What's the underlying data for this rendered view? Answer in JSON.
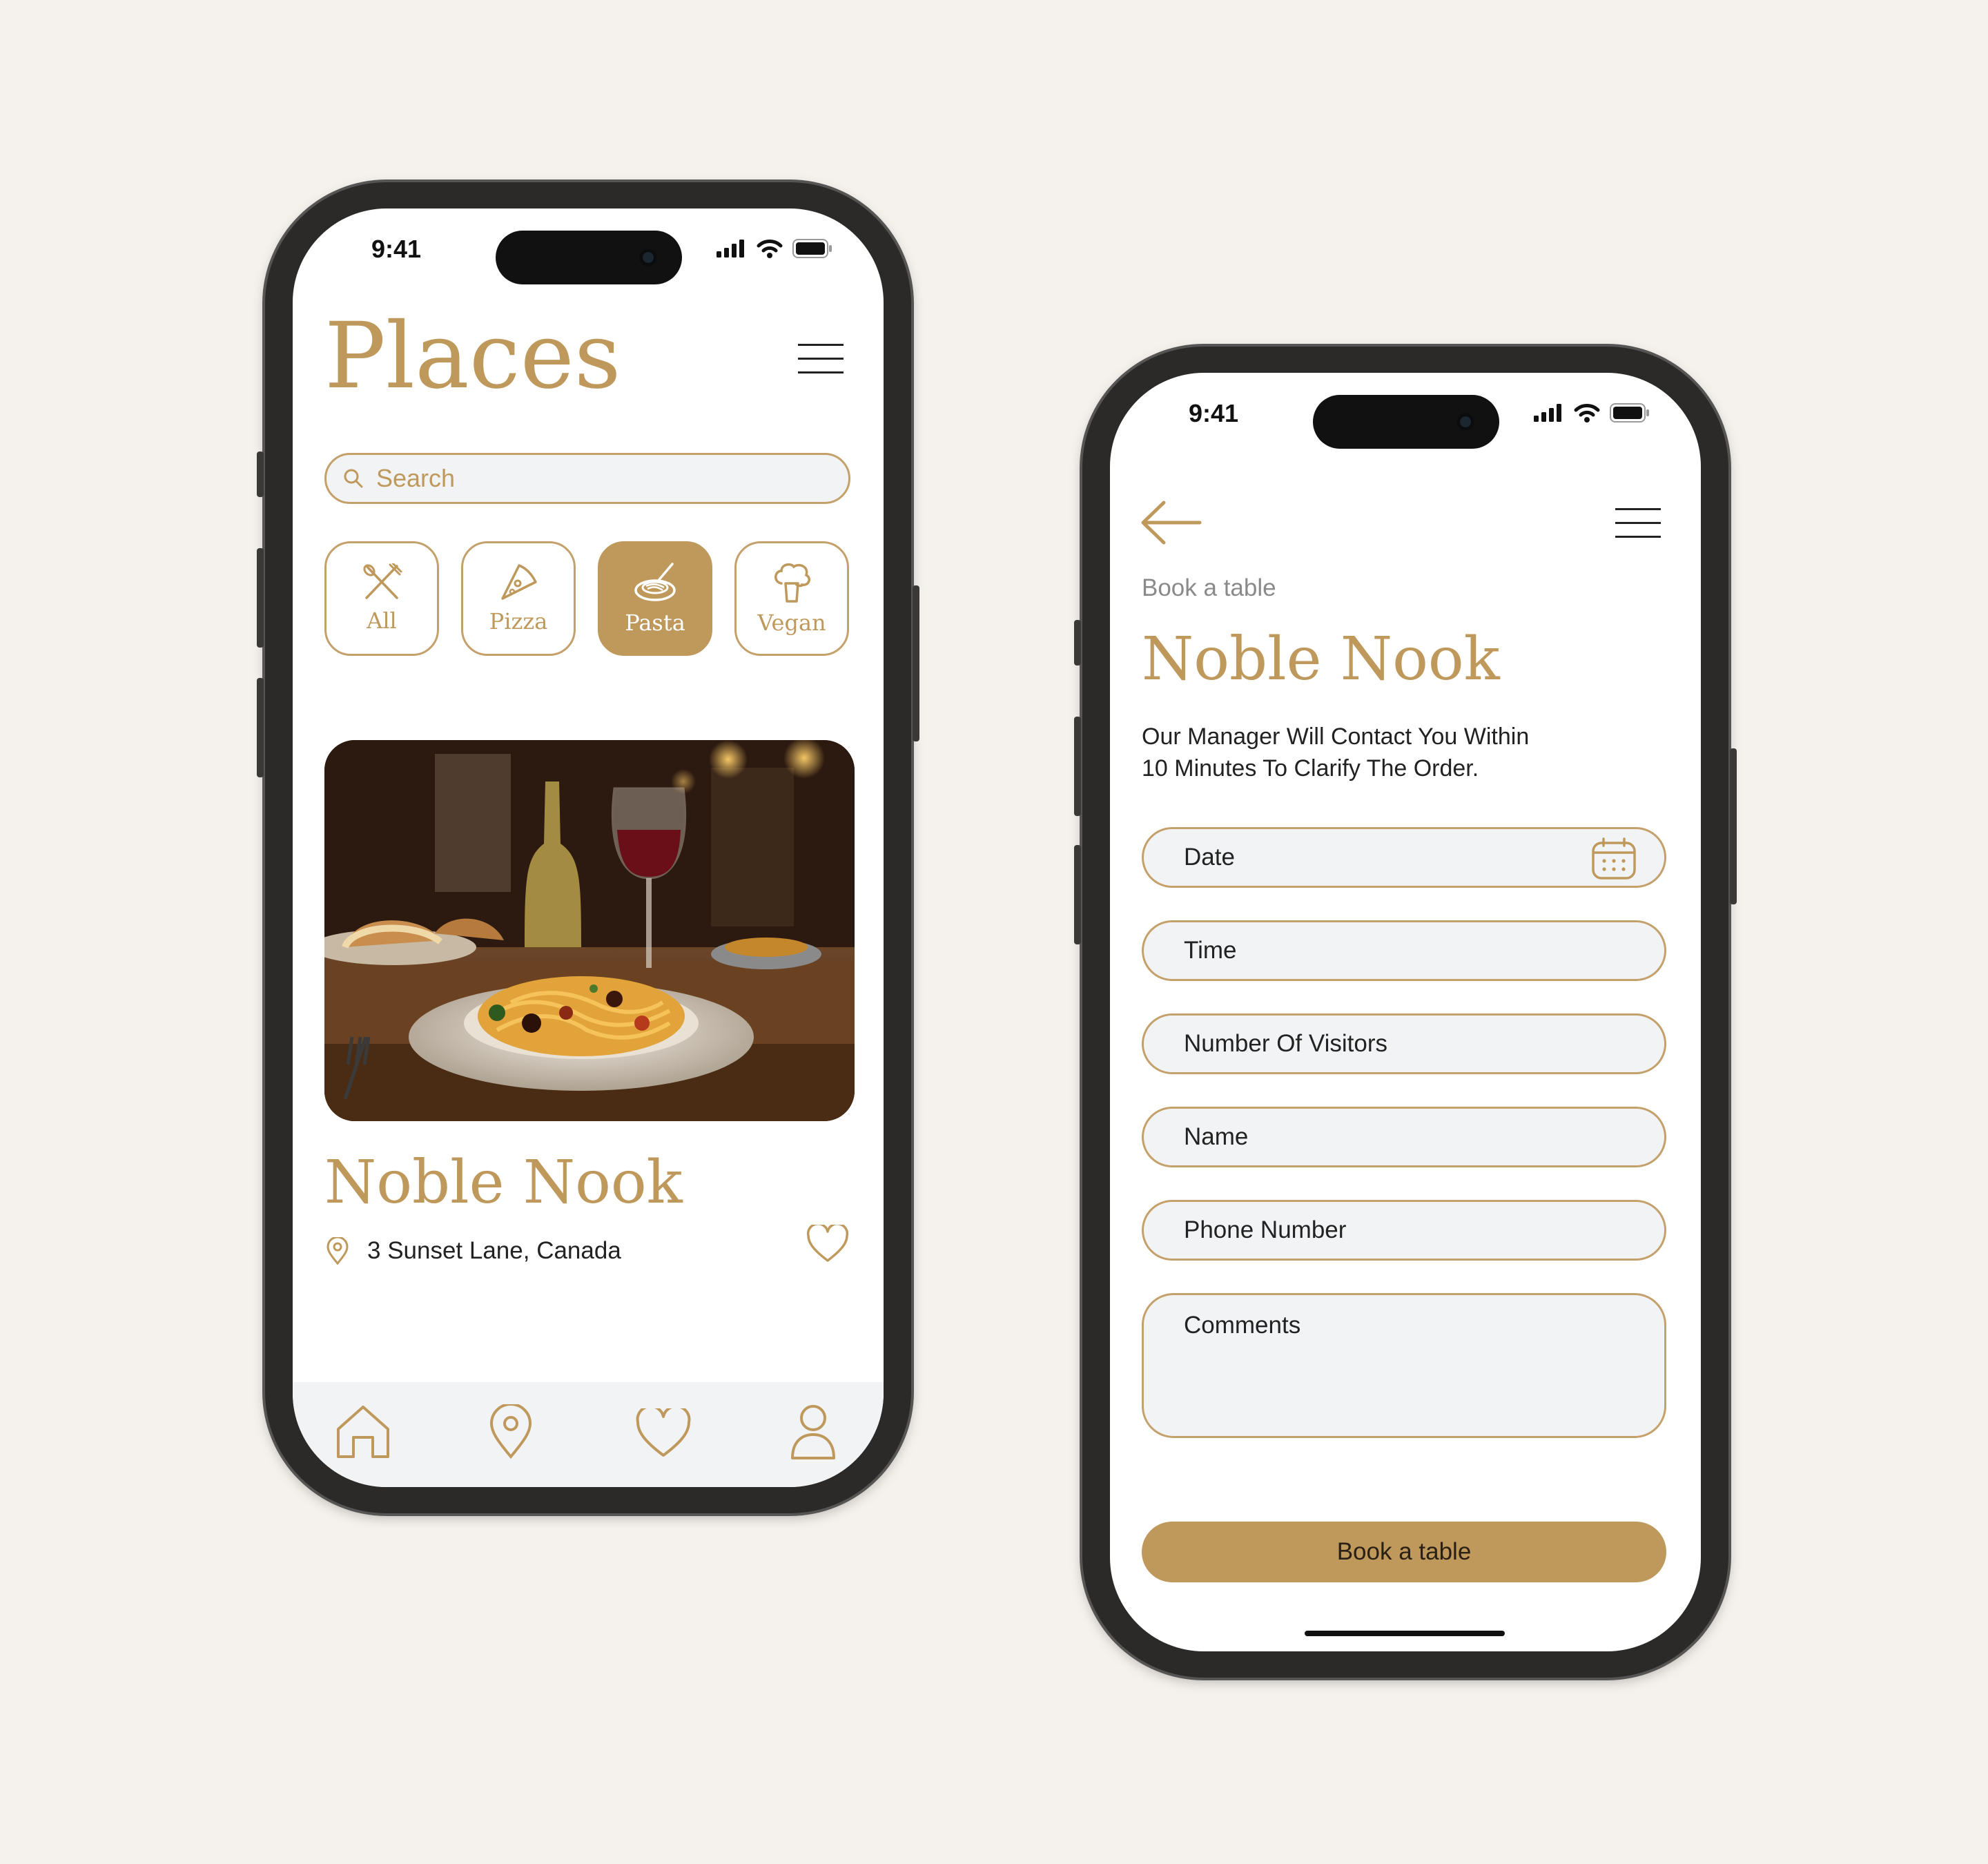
{
  "theme": {
    "accent": "#bf995c",
    "field_bg": "#f2f3f5",
    "page_bg": "#f5f1ec"
  },
  "left_phone": {
    "status_time": "9:41",
    "title": "Places",
    "menu_icon": "hamburger-icon",
    "search": {
      "placeholder": "Search",
      "icon": "search-icon"
    },
    "categories": [
      {
        "label": "All",
        "icon": "utensils-icon",
        "active": false
      },
      {
        "label": "Pizza",
        "icon": "pizza-icon",
        "active": false
      },
      {
        "label": "Pasta",
        "icon": "pasta-icon",
        "active": true
      },
      {
        "label": "Vegan",
        "icon": "broccoli-icon",
        "active": false
      }
    ],
    "card": {
      "image": "pasta-dish-photo",
      "name": "Noble Nook",
      "address": "3 Sunset Lane, Canada",
      "location_icon": "location-pin-icon",
      "favorite_icon": "heart-icon"
    },
    "bottom_nav": [
      {
        "icon": "home-icon"
      },
      {
        "icon": "location-pin-icon"
      },
      {
        "icon": "heart-icon"
      },
      {
        "icon": "user-icon"
      }
    ]
  },
  "right_phone": {
    "status_time": "9:41",
    "back_icon": "arrow-left-icon",
    "menu_icon": "hamburger-icon",
    "breadcrumb": "Book a table",
    "title": "Noble Nook",
    "description_line1": "Our Manager Will Contact You Within",
    "description_line2": "10 Minutes To Clarify The Order.",
    "fields": {
      "date": "Date",
      "time": "Time",
      "visitors": "Number Of Visitors",
      "name": "Name",
      "phone": "Phone Number",
      "comments": "Comments"
    },
    "calendar_icon": "calendar-icon",
    "submit_label": "Book a table"
  }
}
